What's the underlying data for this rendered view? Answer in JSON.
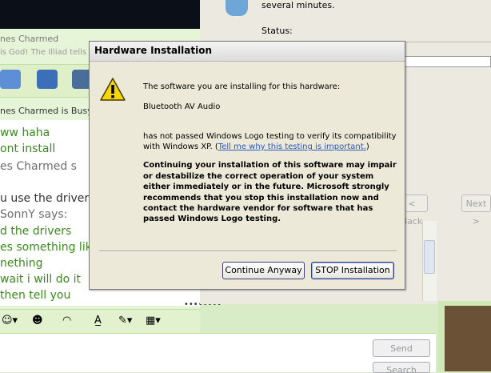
{
  "messenger": {
    "contact_header_name": "nes Charmed",
    "contact_status_message": "is God! The Illiad tells m",
    "chat_header_name": "nes Charmed is Busy",
    "chat_lines": [
      {
        "text": "ww haha",
        "color": "#3b8a1e"
      },
      {
        "text": "ont install",
        "color": "#3b8a1e"
      },
      {
        "text": "es Charmed s",
        "color": "#6f6f6f"
      },
      {
        "text": "u use the drivers",
        "color": "#333333"
      },
      {
        "text": "SonnY says:",
        "color": "#6f6f6f"
      },
      {
        "text": "d the drivers",
        "color": "#3b8a1e"
      },
      {
        "text": "es something lik",
        "color": "#3b8a1e"
      },
      {
        "text": "nething",
        "color": "#3b8a1e"
      },
      {
        "text": "wait i will do it",
        "color": "#3b8a1e"
      },
      {
        "text": "then tell you",
        "color": "#3b8a1e"
      }
    ],
    "resize_grip": "••••••••",
    "send_label": "Send",
    "search_label": "Search"
  },
  "wizard": {
    "progress_text": "several minutes.",
    "status_label": "Status:",
    "back_label": "< Back",
    "next_label": "Next >"
  },
  "dialog": {
    "title": "Hardware Installation",
    "line1": "The software you are installing for this hardware:",
    "device_name": "Bluetooth AV Audio",
    "line2": "has not passed Windows Logo testing to verify its compatibility",
    "line3_prefix": "with Windows XP. (",
    "link_text": "Tell me why this testing is important.",
    "line3_suffix": ")",
    "warning_lines": [
      "Continuing your installation of this software may impair",
      "or destabilize the correct operation of your system",
      "either immediately or in the future. Microsoft strongly",
      "recommends that you stop this installation now and",
      "contact the hardware vendor for software that has",
      "passed Windows Logo testing."
    ],
    "continue_label": "Continue Anyway",
    "stop_label": "STOP Installation"
  }
}
